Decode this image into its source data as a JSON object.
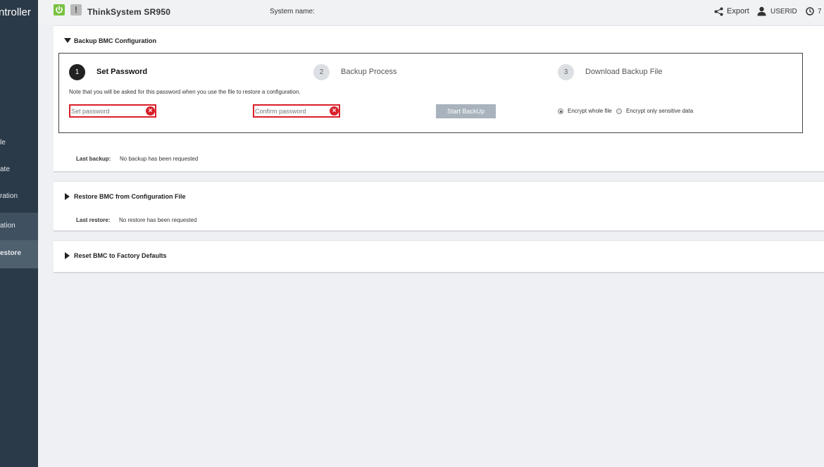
{
  "sidebar": {
    "brand": "ntroller",
    "items": [
      {
        "label": "le"
      },
      {
        "label": "ate"
      },
      {
        "label": "ration"
      },
      {
        "label": "ation"
      },
      {
        "label": "estore"
      }
    ]
  },
  "header": {
    "product": "ThinkSystem SR950",
    "system_name_label": "System name:",
    "export_label": "Export",
    "user_label": "USERID",
    "clock_label": "7",
    "warning_glyph": "!"
  },
  "backup_panel": {
    "title": "Backup BMC Configuration",
    "steps": [
      {
        "number": "1",
        "label": "Set Password"
      },
      {
        "number": "2",
        "label": "Backup Process"
      },
      {
        "number": "3",
        "label": "Download Backup File"
      }
    ],
    "note": "Note that you will be asked for this password when you use the file to restore a configuration.",
    "set_password_placeholder": "Set password",
    "confirm_password_placeholder": "Confirm password",
    "start_button": "Start BackUp",
    "radio_whole": "Encrypt whole file",
    "radio_sensitive": "Encrypt only sensitive data",
    "last_backup_label": "Last backup:",
    "last_backup_value": "No backup has been requested"
  },
  "restore_panel": {
    "title": "Restore BMC from Configuration File",
    "last_restore_label": "Last restore:",
    "last_restore_value": "No restore has been requested"
  },
  "reset_panel": {
    "title": "Reset BMC to Factory Defaults"
  },
  "colors": {
    "sidebar_bg": "#2b3a48",
    "power_green": "#7ac142",
    "error_red": "#d9202a",
    "button_disabled": "#a9b3bd"
  }
}
